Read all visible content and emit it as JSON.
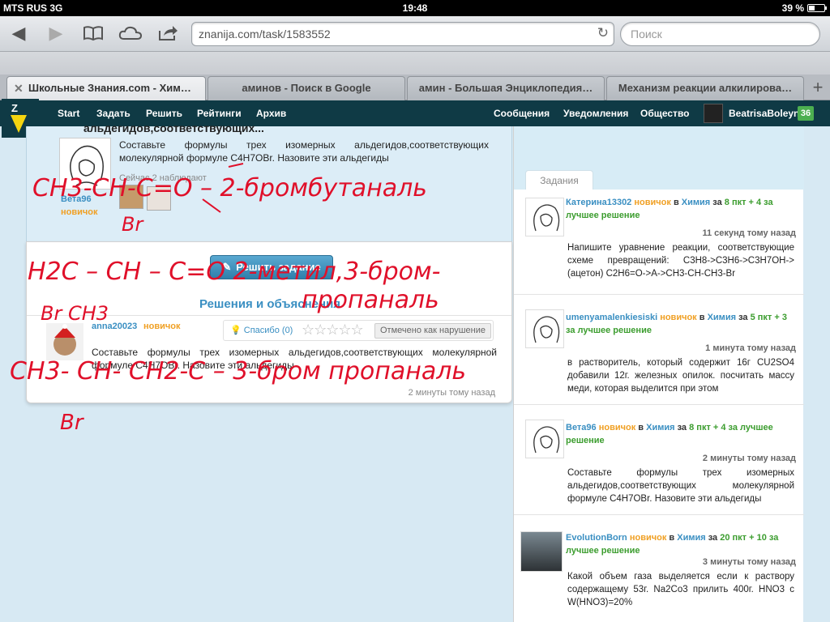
{
  "status": {
    "carrier": "MTS RUS  3G",
    "time": "19:48",
    "battery": "39 %"
  },
  "toolbar": {
    "back_icon": "chevron-left-icon",
    "forward_icon": "chevron-right-icon",
    "url": "znanija.com/task/1583552",
    "search_placeholder": "Поиск"
  },
  "tabs": [
    {
      "label": "Школьные Знания.com - Хим…",
      "active": true
    },
    {
      "label": "аминов - Поиск в Google",
      "active": false
    },
    {
      "label": "амин - Большая Энциклопедия…",
      "active": false
    },
    {
      "label": "Механизм реакции алкилирова…",
      "active": false
    }
  ],
  "nav": {
    "logo": "Z",
    "items": [
      "Start",
      "Задать",
      "Решить",
      "Рейтинги",
      "Архив"
    ],
    "right": [
      "Сообщения",
      "Уведомления",
      "Общество"
    ],
    "username": "BeatrisaBoleyn",
    "points": "36"
  },
  "question": {
    "title": "альдегидов,соответствующих...",
    "text": "Составьте формулы трех изомерных альдегидов,соответствующих молекулярной формуле C4H7OBr. Назовите эти альдегиды",
    "watching": "Сейчас 2 наблюдают",
    "user": "Вета96",
    "rank": "новичок"
  },
  "solve_button": "Решить задание",
  "solutions_heading": "Решения и объяснения",
  "answer": {
    "user": "anna20023",
    "rank": "новичок",
    "thanks": "Спасибо (0)",
    "stars": "☆☆☆☆☆",
    "report": "Отмечено как нарушение",
    "text": "Составьте формулы трех изомерных альдегидов,соответствующих молекулярной формуле C4H7OBr. Назовите эти альдегиды",
    "time": "2 минуты тому назад"
  },
  "sidebar": {
    "tab": "Задания",
    "tasks": [
      {
        "user": "Катерина13302",
        "rank": "новичок",
        "in": "в",
        "subject": "Химия",
        "for": "за",
        "points": "8 пкт + 4 за лучшее решение",
        "time": "11 секунд тому назад",
        "text": "Напишите уравнение реакции, соответствующие схеме превращений: C3H8->C3H6->C3H7OH->(ацетон) C2H6=O->A->CH3-CH-CH3-Br"
      },
      {
        "user": "umenyamalenkiesiski",
        "rank": "новичок",
        "in": "в",
        "subject": "Химия",
        "for": "за",
        "points": "5 пкт + 3 за лучшее решение",
        "time": "1 минута тому назад",
        "text": "в растворитель, который содержит 16г CU2SO4 добавили 12г. железных опилок. посчитать массу меди, которая выделится при этом"
      },
      {
        "user": "Вета96",
        "rank": "новичок",
        "in": "в",
        "subject": "Химия",
        "for": "за",
        "points": "8 пкт + 4 за лучшее решение",
        "time": "2 минуты тому назад",
        "text": "Составьте формулы трех изомерных альдегидов,соответствующих молекулярной формуле C4H7OBr. Назовите эти альдегиды"
      },
      {
        "user": "EvolutionBorn",
        "rank": "новичок",
        "in": "в",
        "subject": "Химия",
        "for": "за",
        "points": "20 пкт + 10 за лучшее решение",
        "time": "3 минуты тому назад",
        "text": "Какой объем газа выделяется если к раствору содержащему 53г. Na2Co3 прилить 400г. HNO3 с W(HNO3)=20%"
      }
    ]
  },
  "ink": {
    "line1": "CH3-CH-C=O  – 2-бромбутаналь",
    "line1_sub": "Br",
    "line2": "H2C – CH – C=O   2-метил,3-бром-",
    "line2b": "пропаналь",
    "line2_sub": "Br  CH3",
    "line3": "CH3- CH- CH2-C   – 3-бром пропаналь",
    "line3_sub": "Br"
  }
}
